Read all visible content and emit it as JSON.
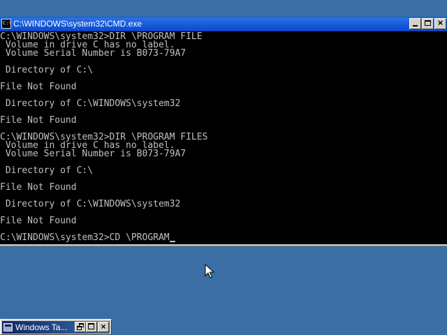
{
  "window": {
    "title": "C:\\WINDOWS\\system32\\CMD.exe",
    "icon_text": "C:\\",
    "icons": [
      "cmd-app-icon",
      "minimize-icon",
      "maximize-icon",
      "close-icon"
    ]
  },
  "console": {
    "lines": [
      "C:\\WINDOWS\\system32>DIR \\PROGRAM FILE",
      " Volume in drive C has no label.",
      " Volume Serial Number is B073-79A7",
      "",
      " Directory of C:\\",
      "",
      "File Not Found",
      "",
      " Directory of C:\\WINDOWS\\system32",
      "",
      "File Not Found",
      "",
      "C:\\WINDOWS\\system32>DIR \\PROGRAM FILES",
      " Volume in drive C has no label.",
      " Volume Serial Number is B073-79A7",
      "",
      " Directory of C:\\",
      "",
      "File Not Found",
      "",
      " Directory of C:\\WINDOWS\\system32",
      "",
      "File Not Found",
      "",
      "C:\\WINDOWS\\system32>CD \\PROGRAM"
    ],
    "colors": {
      "background": "#000000",
      "text": "#c0c0c0"
    }
  },
  "minimized_window": {
    "title": "Windows Ta...",
    "icons": [
      "window-icon",
      "restore-icon",
      "maximize-icon",
      "close-icon"
    ]
  },
  "desktop": {
    "background": "#3a6ea5"
  },
  "cursor": {
    "icon": "arrow-pointer-icon"
  }
}
